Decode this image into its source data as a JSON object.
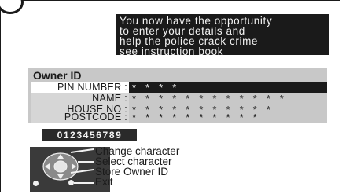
{
  "message": {
    "lines": [
      "You now have the opportunity",
      "to enter your details and",
      "help the police crack crime",
      "see instruction book"
    ]
  },
  "owner_id": {
    "title": "Owner ID",
    "fields": [
      {
        "label": "PIN NUMBER :",
        "value": "* * * *"
      },
      {
        "label": "NAME :",
        "value": "* * * * * * * * * * * *"
      },
      {
        "label": "HOUSE NO :",
        "value": "* * * * * * * * * * *"
      },
      {
        "label": "POSTCODE :",
        "value": "* * * * * * * * * *"
      }
    ]
  },
  "digits": "0123456789",
  "help": {
    "change": "Change character",
    "select": "Select character",
    "store": "Store Owner ID",
    "exit": "Exit"
  },
  "colors": {
    "highlight": "#1a1a1a",
    "panel": "#c8c8c8",
    "label_bg": "#d6d6d6"
  }
}
